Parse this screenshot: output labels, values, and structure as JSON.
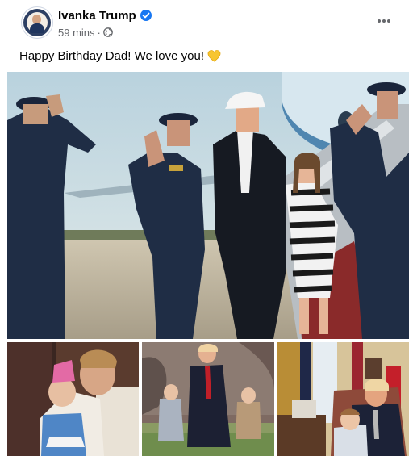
{
  "post": {
    "author": "Ivanka Trump",
    "timestamp": "59 mins",
    "separator": "·",
    "caption": "Happy Birthday Dad! We love you!",
    "verified_icon": "verified-badge-icon",
    "audience_icon": "globe-icon",
    "caption_emoji": "yellow-heart-icon",
    "more_icon": "more-options-icon"
  },
  "photos": [
    {
      "name": "photo-air-force-salute",
      "description_visible": false
    },
    {
      "name": "photo-vintage-father-daughter",
      "description_visible": false
    },
    {
      "name": "photo-white-house-lawn-walk",
      "description_visible": false
    },
    {
      "name": "photo-oval-office-with-grandson",
      "description_visible": false
    }
  ],
  "colors": {
    "author": "#050505",
    "meta": "#65676b",
    "verified": "#1877f2",
    "heart": "#f7c531"
  }
}
